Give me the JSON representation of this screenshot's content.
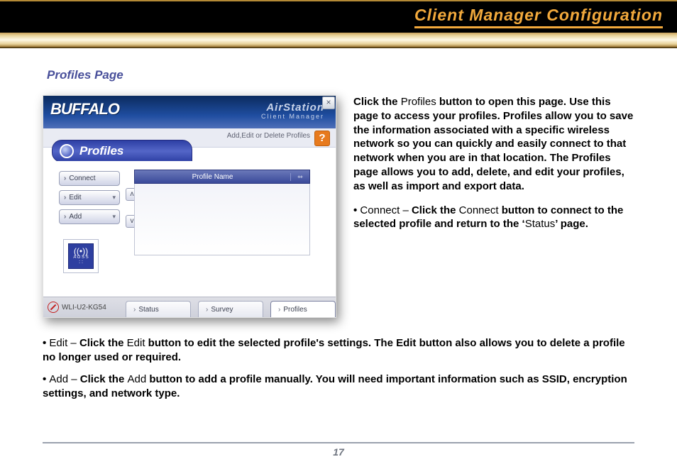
{
  "header": {
    "title": "Client Manager Configuration"
  },
  "subtitle": "Profiles Page",
  "shot": {
    "brand": "BUFFALO",
    "brand2_line1": "AirStation",
    "brand2_line2": "Client Manager",
    "subbar_label": "Add,Edit or Delete Profiles",
    "help": "?",
    "close": "×",
    "profiles_label": "Profiles",
    "side_buttons": {
      "connect": "Connect",
      "edit": "Edit",
      "add": "Add"
    },
    "list_header": "Profile Name",
    "list_header_icon": "⇿",
    "updown": {
      "up": "ʌ",
      "down": "v"
    },
    "aoss": {
      "label": "A O S S",
      "wave": "((•))",
      "dots": ": :"
    },
    "device": "WLI-U2-KG54",
    "tabs": {
      "status": "Status",
      "survey": "Survey",
      "profiles": "Profiles"
    }
  },
  "desc": {
    "p1a": "Click the ",
    "p1b": "Profiles",
    "p1c": " button to open this page. Use this page to access your profiles. Profiles allow you to save the information associated with a specific wireless network so you can quickly and easily connect to that network when you are in that location. The Profiles page allows you to add, delete, and edit your profiles, as well as import and export data.",
    "connect_lead": "• ",
    "connect_thin": "Connect – ",
    "connect_bold1": "Click the ",
    "connect_thin2": "Connect",
    "connect_bold2": " button to connect to the selected profile and return to the ‘",
    "connect_thin3": "Status",
    "connect_bold3": "’ page.",
    "edit_lead": "• ",
    "edit_thin": "Edit – ",
    "edit_bold1": "Click the ",
    "edit_thin2": "Edit",
    "edit_bold2": " button to edit the selected profile's settings.  The Edit button also allows you to delete a profile no longer used or required.",
    "add_lead": "• ",
    "add_thin": "Add – ",
    "add_bold1": "Click the ",
    "add_thin2": "Add",
    "add_bold2": " button to add a profile manually.  You will need important information such as SSID, encryption settings, and network type."
  },
  "page_number": "17"
}
